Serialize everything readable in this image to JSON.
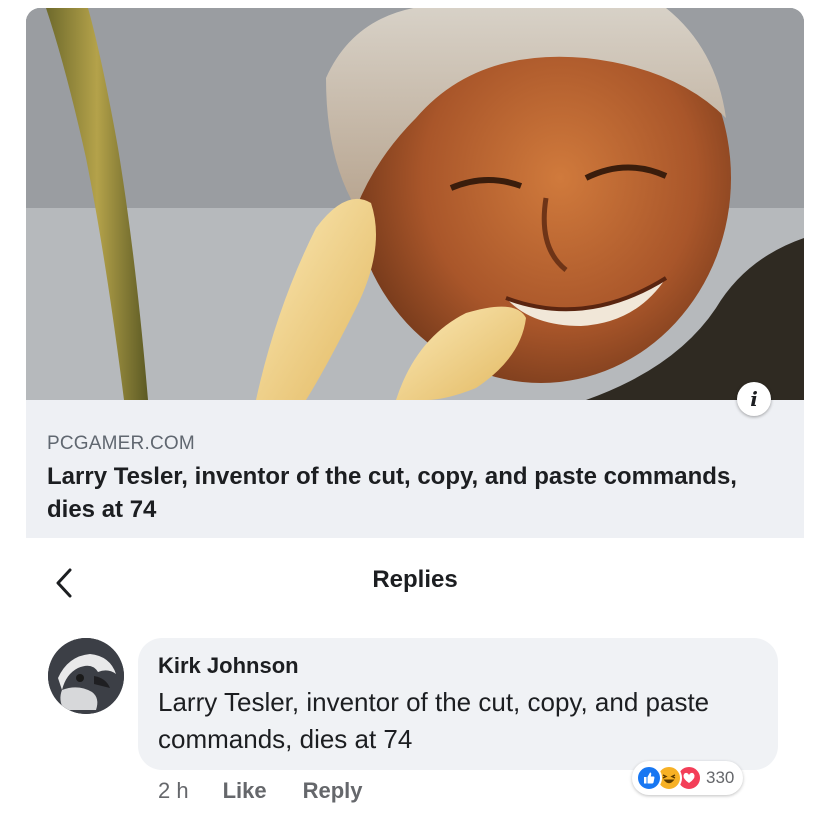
{
  "link_preview": {
    "domain": "PCGAMER.COM",
    "title": "Larry Tesler, inventor of the cut, copy, and paste commands, dies at 74",
    "info_icon": "info-icon"
  },
  "replies_header": {
    "title": "Replies",
    "back_icon": "chevron-left-icon"
  },
  "comment": {
    "author": "Kirk Johnson",
    "text": "Larry Tesler, inventor of the cut, copy, and paste commands, dies at 74",
    "timestamp": "2 h",
    "like_label": "Like",
    "reply_label": "Reply",
    "reactions": {
      "types": [
        "like",
        "haha",
        "love"
      ],
      "count": "330"
    }
  },
  "colors": {
    "card_background": "#eef0f4",
    "bubble_background": "#f0f2f5",
    "like_blue": "#1877f2",
    "haha_yellow": "#f7b125",
    "love_red": "#f33e58",
    "secondary_text": "#65676b"
  }
}
